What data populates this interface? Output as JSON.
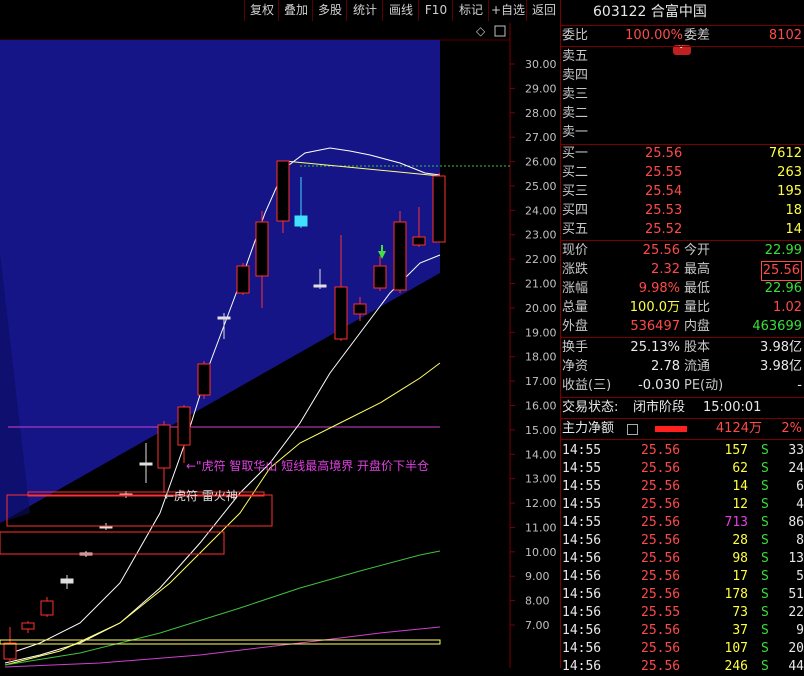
{
  "toolbar": {
    "buttons": [
      "复权",
      "叠加",
      "多股",
      "统计",
      "画线",
      "F10",
      "标记",
      "+自选",
      "返回"
    ]
  },
  "chart": {
    "y_axis_labels": [
      "30.00",
      "29.00",
      "28.00",
      "27.00",
      "26.00",
      "25.00",
      "24.00",
      "23.00",
      "22.00",
      "21.00",
      "20.00",
      "19.00",
      "18.00",
      "17.00",
      "16.00",
      "15.00",
      "14.00",
      "13.00",
      "12.00",
      "11.00",
      "10.00",
      "9.00",
      "8.00",
      "7.00"
    ],
    "annotation_1": "←\"虎符 智取华山 短线最高境界 开盘价下半仓",
    "annotation_2": "←虎符 雷火神",
    "diamond_icon": "◇",
    "scroll_icon": "▭",
    "colors": {
      "up": "#ff3030",
      "down": "#40e0ff",
      "channel": "#1a1aa0",
      "ma1": "#ffffff",
      "ma2": "#ffff60",
      "ma3": "#40c040",
      "ma4": "#d040d0"
    }
  },
  "quote": {
    "code": "603122",
    "name": "合富中国",
    "weibi_label": "委比",
    "weibi_value": "100.00%",
    "weicha_label": "委差",
    "weicha_value": "8102",
    "sell": [
      {
        "label": "卖五",
        "price": "",
        "vol": ""
      },
      {
        "label": "卖四",
        "price": "",
        "vol": ""
      },
      {
        "label": "卖三",
        "price": "",
        "vol": ""
      },
      {
        "label": "卖二",
        "price": "",
        "vol": ""
      },
      {
        "label": "卖一",
        "price": "",
        "vol": ""
      }
    ],
    "buy": [
      {
        "label": "买一",
        "price": "25.56",
        "vol": "7612"
      },
      {
        "label": "买二",
        "price": "25.55",
        "vol": "263"
      },
      {
        "label": "买三",
        "price": "25.54",
        "vol": "195"
      },
      {
        "label": "买四",
        "price": "25.53",
        "vol": "18"
      },
      {
        "label": "买五",
        "price": "25.52",
        "vol": "14"
      }
    ],
    "stats": [
      {
        "l1": "现价",
        "v1": "25.56",
        "c1": "red",
        "l2": "今开",
        "v2": "22.99",
        "c2": "green"
      },
      {
        "l1": "涨跌",
        "v1": "2.32",
        "c1": "red",
        "l2": "最高",
        "v2": "25.56",
        "c2": "red"
      },
      {
        "l1": "涨幅",
        "v1": "9.98%",
        "c1": "red",
        "l2": "最低",
        "v2": "22.96",
        "c2": "green"
      },
      {
        "l1": "总量",
        "v1": "100.0万",
        "c1": "yellow",
        "l2": "量比",
        "v2": "1.02",
        "c2": "red"
      },
      {
        "l1": "外盘",
        "v1": "536497",
        "c1": "red",
        "l2": "内盘",
        "v2": "463699",
        "c2": "green"
      }
    ],
    "stats2": [
      {
        "l1": "换手",
        "v1": "25.13%",
        "l2": "股本",
        "v2": "3.98亿"
      },
      {
        "l1": "净资",
        "v1": "2.78",
        "l2": "流通",
        "v2": "3.98亿"
      },
      {
        "l1": "收益(三)",
        "v1": "-0.030",
        "l2": "PE(动)",
        "v2": "-"
      }
    ],
    "trade_status_label": "交易状态:",
    "trade_status_value": "闭市阶段",
    "trade_time": "15:00:01",
    "main_flow_label": "主力净额",
    "main_flow_value": "4124万",
    "main_flow_pct": "2%",
    "ticks": [
      {
        "t": "14:55",
        "p": "25.56",
        "v": "157",
        "s": "S",
        "n": "33",
        "vc": "yellow"
      },
      {
        "t": "14:55",
        "p": "25.56",
        "v": "62",
        "s": "S",
        "n": "24",
        "vc": "yellow"
      },
      {
        "t": "14:55",
        "p": "25.56",
        "v": "14",
        "s": "S",
        "n": "6",
        "vc": "yellow"
      },
      {
        "t": "14:55",
        "p": "25.56",
        "v": "12",
        "s": "S",
        "n": "4",
        "vc": "yellow"
      },
      {
        "t": "14:55",
        "p": "25.56",
        "v": "713",
        "s": "S",
        "n": "86",
        "vc": "magenta"
      },
      {
        "t": "14:56",
        "p": "25.56",
        "v": "28",
        "s": "S",
        "n": "8",
        "vc": "yellow"
      },
      {
        "t": "14:56",
        "p": "25.56",
        "v": "98",
        "s": "S",
        "n": "13",
        "vc": "yellow"
      },
      {
        "t": "14:56",
        "p": "25.56",
        "v": "17",
        "s": "S",
        "n": "5",
        "vc": "yellow"
      },
      {
        "t": "14:56",
        "p": "25.56",
        "v": "178",
        "s": "S",
        "n": "51",
        "vc": "yellow"
      },
      {
        "t": "14:56",
        "p": "25.55",
        "v": "73",
        "s": "S",
        "n": "22",
        "vc": "yellow"
      },
      {
        "t": "14:56",
        "p": "25.56",
        "v": "37",
        "s": "S",
        "n": "9",
        "vc": "yellow"
      },
      {
        "t": "14:56",
        "p": "25.56",
        "v": "107",
        "s": "S",
        "n": "20",
        "vc": "yellow"
      },
      {
        "t": "14:56",
        "p": "25.56",
        "v": "246",
        "s": "S",
        "n": "44",
        "vc": "yellow"
      }
    ]
  }
}
